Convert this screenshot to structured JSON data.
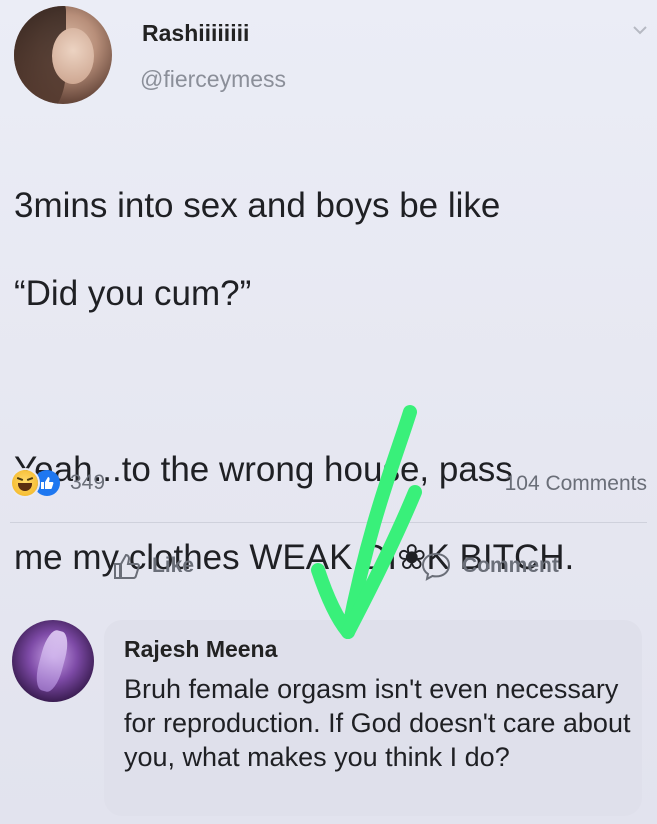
{
  "post": {
    "username": "Rashiiiiiiii",
    "handle": "@fierceymess",
    "text_line1": "3mins into sex and boys be like",
    "text_line2": "“Did you cum?”",
    "text_line3": "Yeah...to the wrong house, pass",
    "text_line4": "me my clothes WEAK DI❀K BITCH."
  },
  "stats": {
    "reactions_count": "349",
    "comments_count": "104 Comments"
  },
  "actions": {
    "like_label": "Like",
    "comment_label": "Comment"
  },
  "comment": {
    "author": "Rajesh Meena",
    "text": "Bruh female orgasm isn't even necessary for reproduction. If God doesn't care about you, what makes you think I do?"
  },
  "colors": {
    "like_blue": "#1e77f0",
    "arrow_green": "#39f07a",
    "background": "#e7e8f2"
  }
}
